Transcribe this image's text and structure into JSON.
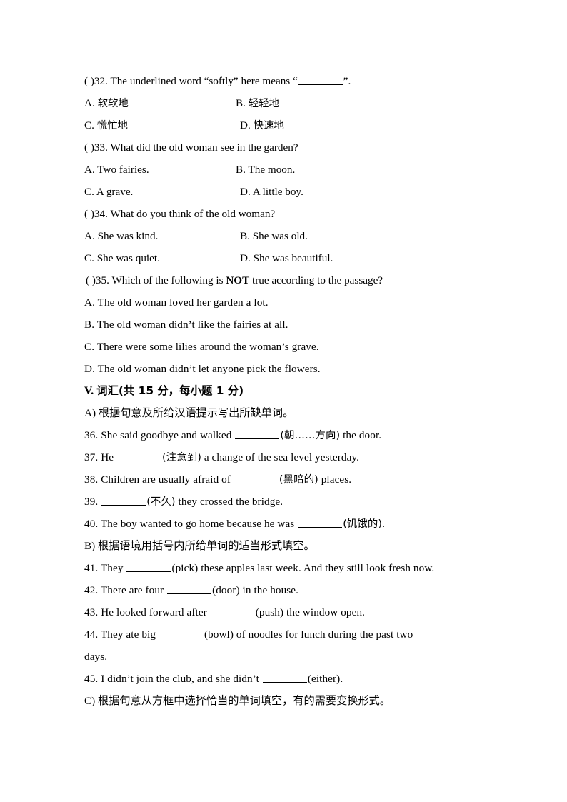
{
  "document": {
    "type": "exam-paper",
    "language": "zh-CN/en",
    "page_background": "#ffffff",
    "text_color": "#000000"
  },
  "reading_questions": [
    {
      "id": "q32",
      "marker": "(    )32.",
      "stem_before": "The underlined word “softly” here means “",
      "stem_after": "”.",
      "has_blank": true,
      "options": [
        {
          "label": "A.",
          "text": "软软地",
          "lang": "zh"
        },
        {
          "label": "B.",
          "text": "轻轻地",
          "lang": "zh"
        },
        {
          "label": "C.",
          "text": "慌忙地",
          "lang": "zh"
        },
        {
          "label": "D.",
          "text": "快速地",
          "lang": "zh"
        }
      ]
    },
    {
      "id": "q33",
      "marker": "(    )33.",
      "stem_before": "What did the old woman see in the garden?",
      "stem_after": "",
      "has_blank": false,
      "options": [
        {
          "label": "A.",
          "text": "Two fairies.",
          "lang": "en"
        },
        {
          "label": "B.",
          "text": "The moon.",
          "lang": "en"
        },
        {
          "label": "C.",
          "text": "A grave.",
          "lang": "en"
        },
        {
          "label": "D.",
          "text": "A little boy.",
          "lang": "en"
        }
      ]
    },
    {
      "id": "q34",
      "marker": "(    )34.",
      "stem_before": "What do you think of the old woman?",
      "stem_after": "",
      "has_blank": false,
      "options": [
        {
          "label": "A.",
          "text": "She was kind.",
          "lang": "en"
        },
        {
          "label": "B.",
          "text": "She was old.",
          "lang": "en"
        },
        {
          "label": "C.",
          "text": "She was quiet.",
          "lang": "en"
        },
        {
          "label": "D.",
          "text": "She was beautiful.",
          "lang": "en"
        }
      ]
    },
    {
      "id": "q35",
      "marker": "(    )35.",
      "stem_before": "Which of the following is ",
      "stem_bold": "NOT",
      "stem_after": " true according to the passage?",
      "has_blank": false,
      "options_stacked": [
        "A. The old woman loved her garden a lot.",
        "B. The old woman didn’t like the fairies at all.",
        "C. There were some lilies around the woman’s grave.",
        "D. The old woman didn’t let anyone pick the flowers."
      ]
    }
  ],
  "section_v": {
    "heading_number": "V.",
    "heading_cn": "词汇(共 15 分，每小题 1 分)",
    "part_a": {
      "label": "A)",
      "instruction_cn": "根据句意及所给汉语提示写出所缺单词。",
      "items": [
        {
          "number": "36.",
          "before": "She said goodbye and walked ",
          "hint": "(朝……方向)",
          "after": " the door."
        },
        {
          "number": "37.",
          "before": "He ",
          "hint": "(注意到)",
          "after": " a change of the sea level yesterday."
        },
        {
          "number": "38.",
          "before": "Children are usually afraid of ",
          "hint": "(黑暗的)",
          "after": " places."
        },
        {
          "number": "39.",
          "before": " ",
          "hint": "(不久)",
          "after": " they crossed the bridge."
        },
        {
          "number": "40.",
          "before": "The boy wanted to go home because he was ",
          "hint": "(饥饿的)",
          "after": "."
        }
      ]
    },
    "part_b": {
      "label": "B)",
      "instruction_cn": "根据语境用括号内所给单词的适当形式填空。",
      "items": [
        {
          "number": "41.",
          "before": "They ",
          "hint": "(pick)",
          "after": " these apples last week. And they still look fresh now.",
          "wrap_tail": ""
        },
        {
          "number": "42.",
          "before": "There are four ",
          "hint": "(door)",
          "after": " in the house.",
          "wrap_tail": ""
        },
        {
          "number": "43.",
          "before": "He looked forward after ",
          "hint": "(push)",
          "after": " the window open.",
          "wrap_tail": ""
        },
        {
          "number": "44.",
          "before": "They ate big ",
          "hint": "(bowl)",
          "after": " of noodles for lunch during the past two",
          "wrap_tail": "days."
        },
        {
          "number": "45.",
          "before": "I didn’t join the club, and she didn’t ",
          "hint": "(either)",
          "after": ".",
          "wrap_tail": ""
        }
      ]
    },
    "part_c": {
      "label": "C)",
      "instruction_cn": "根据句意从方框中选择恰当的单词填空，有的需要变换形式。"
    }
  }
}
